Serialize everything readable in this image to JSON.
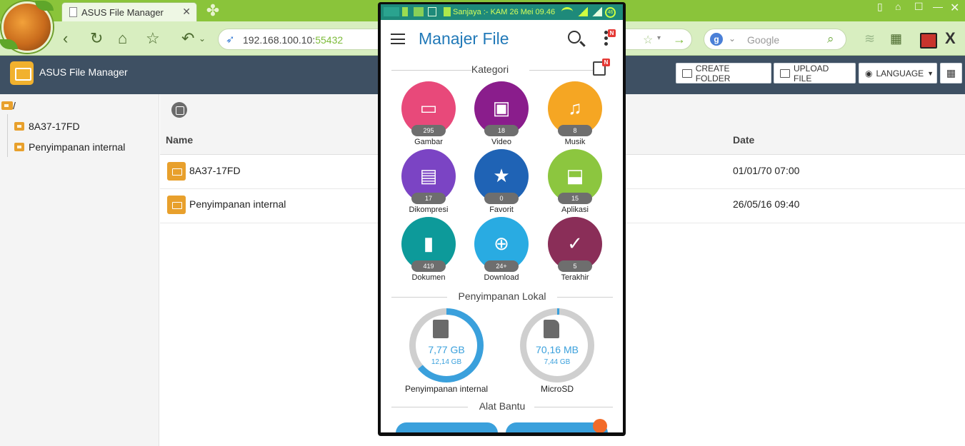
{
  "browser": {
    "tab_title": "ASUS File Manager",
    "url_host": "192.168.100.10:",
    "url_port": "55432",
    "search_placeholder": "Google"
  },
  "app": {
    "title": "ASUS File Manager",
    "buttons": {
      "create_folder": "CREATE FOLDER",
      "upload_file": "UPLOAD FILE",
      "language": "LANGUAGE"
    },
    "tree": {
      "root": "/",
      "items": [
        "8A37-17FD",
        "Penyimpanan internal"
      ]
    },
    "table": {
      "headers": {
        "name": "Name",
        "date": "Date"
      },
      "rows": [
        {
          "name": "8A37-17FD",
          "date": "01/01/70 07:00"
        },
        {
          "name": "Penyimpanan internal",
          "date": "26/05/16 09:40"
        }
      ]
    }
  },
  "phone": {
    "status_text": "Sanjaya :- KAM 26 Mei 09.46",
    "battery": "46",
    "title": "Manajer File",
    "sections": {
      "categories": "Kategori",
      "local_storage": "Penyimpanan Lokal",
      "tools": "Alat Bantu"
    },
    "categories": [
      {
        "label": "Gambar",
        "count": "295",
        "color": "#e8497a",
        "icon": "image-icon"
      },
      {
        "label": "Video",
        "count": "18",
        "color": "#8a1d8c",
        "icon": "film-icon"
      },
      {
        "label": "Musik",
        "count": "8",
        "color": "#f5a623",
        "icon": "music-icon"
      },
      {
        "label": "Dikompresi",
        "count": "17",
        "color": "#7b44c4",
        "icon": "zip-icon"
      },
      {
        "label": "Favorit",
        "count": "0",
        "color": "#1f63b5",
        "icon": "star-icon"
      },
      {
        "label": "Aplikasi",
        "count": "15",
        "color": "#8cc63f",
        "icon": "android-icon"
      },
      {
        "label": "Dokumen",
        "count": "419",
        "color": "#0d9a9a",
        "icon": "document-icon"
      },
      {
        "label": "Download",
        "count": "24+",
        "color": "#29abe2",
        "icon": "download-icon"
      },
      {
        "label": "Terakhir",
        "count": "5",
        "color": "#8a2e58",
        "icon": "recent-check-icon"
      }
    ],
    "storage": [
      {
        "label": "Penyimpanan internal",
        "used": "7,77 GB",
        "total": "12,14 GB",
        "fill_fraction": 0.64,
        "color": "#3aa0dc"
      },
      {
        "label": "MicroSD",
        "used": "70,16 MB",
        "total": "7,44 GB",
        "fill_fraction": 0.01,
        "color": "#3aa0dc"
      }
    ]
  }
}
